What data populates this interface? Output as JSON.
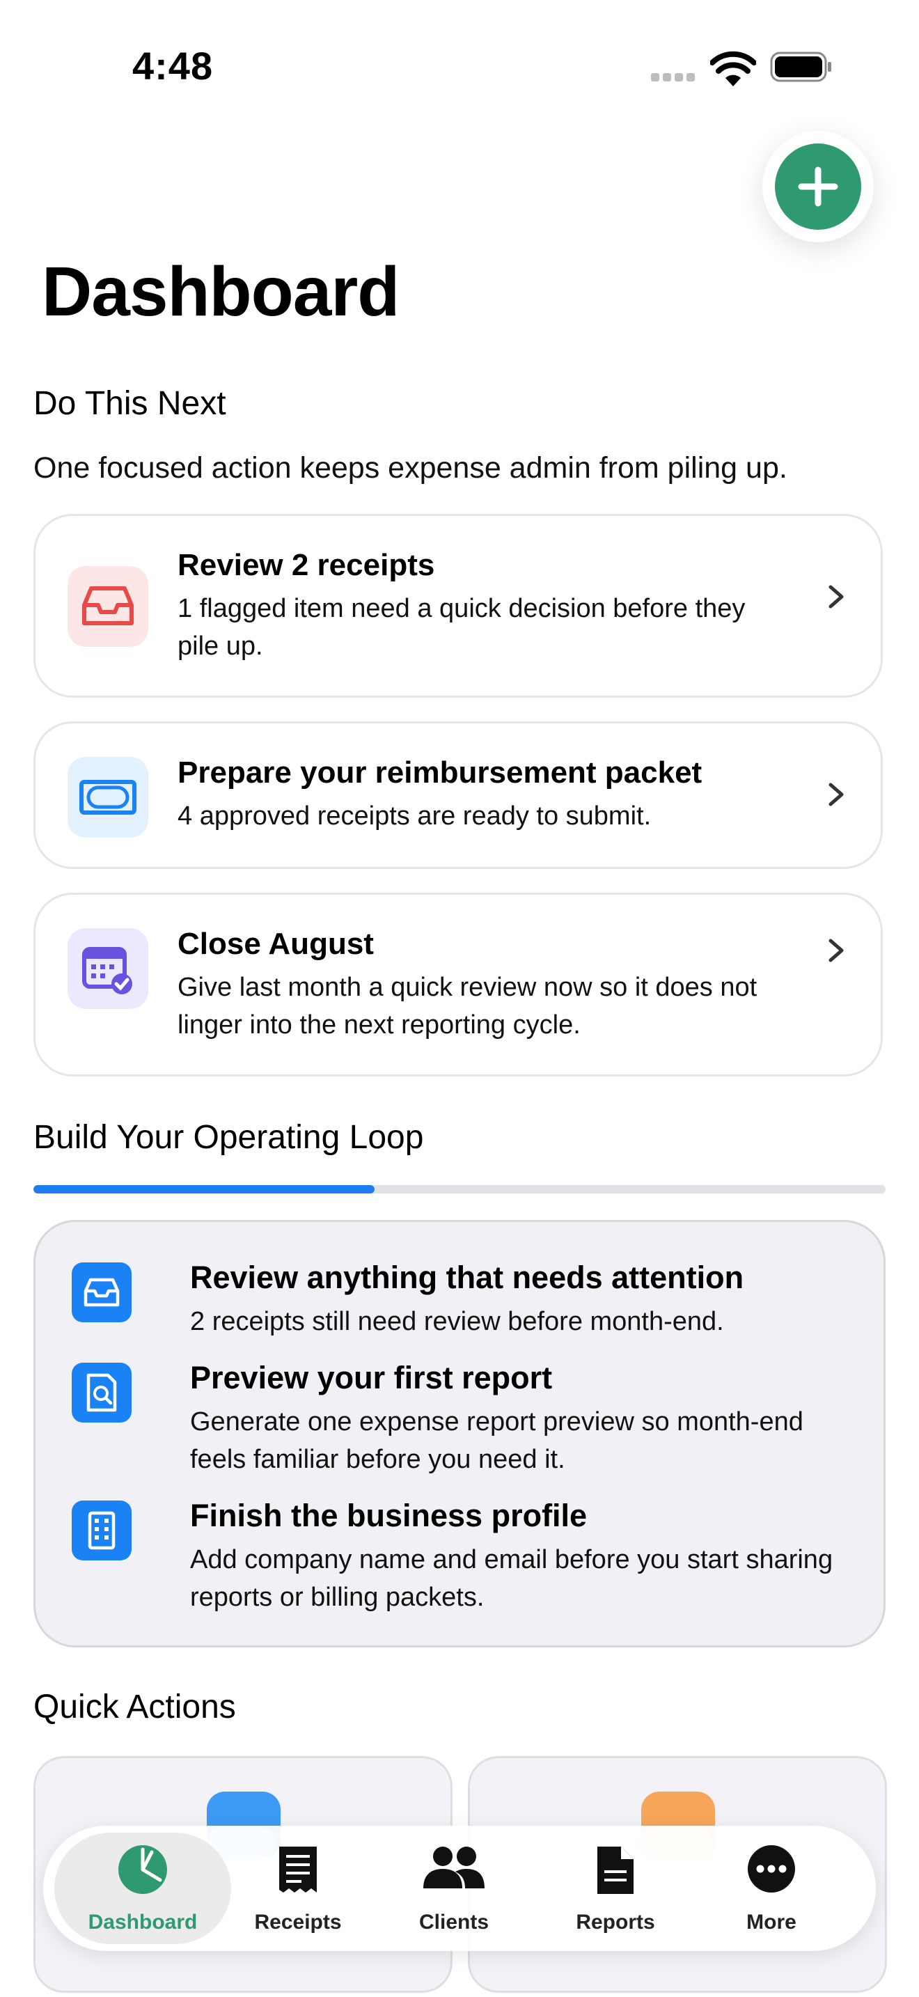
{
  "status_bar": {
    "time": "4:48"
  },
  "page": {
    "title": "Dashboard"
  },
  "do_next": {
    "heading": "Do This Next",
    "subtitle": "One focused action keeps expense admin from piling up.",
    "cards": [
      {
        "title": "Review 2 receipts",
        "description": "1 flagged item need a quick decision before they pile up.",
        "icon": "inbox-tray-icon",
        "color": "#e84a4a"
      },
      {
        "title": "Prepare your reimbursement packet",
        "description": "4 approved receipts are ready to submit.",
        "icon": "banknote-icon",
        "color": "#1a82f5"
      },
      {
        "title": "Close August",
        "description": "Give last month a quick review now so it does not linger into the next reporting cycle.",
        "icon": "calendar-check-icon",
        "color": "#6a52e0"
      }
    ]
  },
  "operating_loop": {
    "heading": "Build Your Operating Loop",
    "progress": 0.4,
    "items": [
      {
        "title": "Review anything that needs attention",
        "description": "2 receipts still need review before month-end.",
        "icon": "inbox-tray-icon"
      },
      {
        "title": "Preview your first report",
        "description": "Generate one expense report preview so month-end feels familiar before you need it.",
        "icon": "report-search-icon"
      },
      {
        "title": "Finish the business profile",
        "description": "Add company name and email before you start sharing reports or billing packets.",
        "icon": "building-icon"
      }
    ]
  },
  "quick_actions": {
    "heading": "Quick Actions"
  },
  "tab_bar": {
    "active": "Dashboard",
    "tabs": [
      {
        "label": "Dashboard",
        "icon": "pie-chart-icon"
      },
      {
        "label": "Receipts",
        "icon": "receipt-icon"
      },
      {
        "label": "Clients",
        "icon": "people-icon"
      },
      {
        "label": "Reports",
        "icon": "document-icon"
      },
      {
        "label": "More",
        "icon": "ellipsis-circle-icon"
      }
    ]
  },
  "colors": {
    "accent_green": "#2f9a6f",
    "accent_blue": "#1a82f5",
    "progress_track": "#e2e2e6"
  }
}
